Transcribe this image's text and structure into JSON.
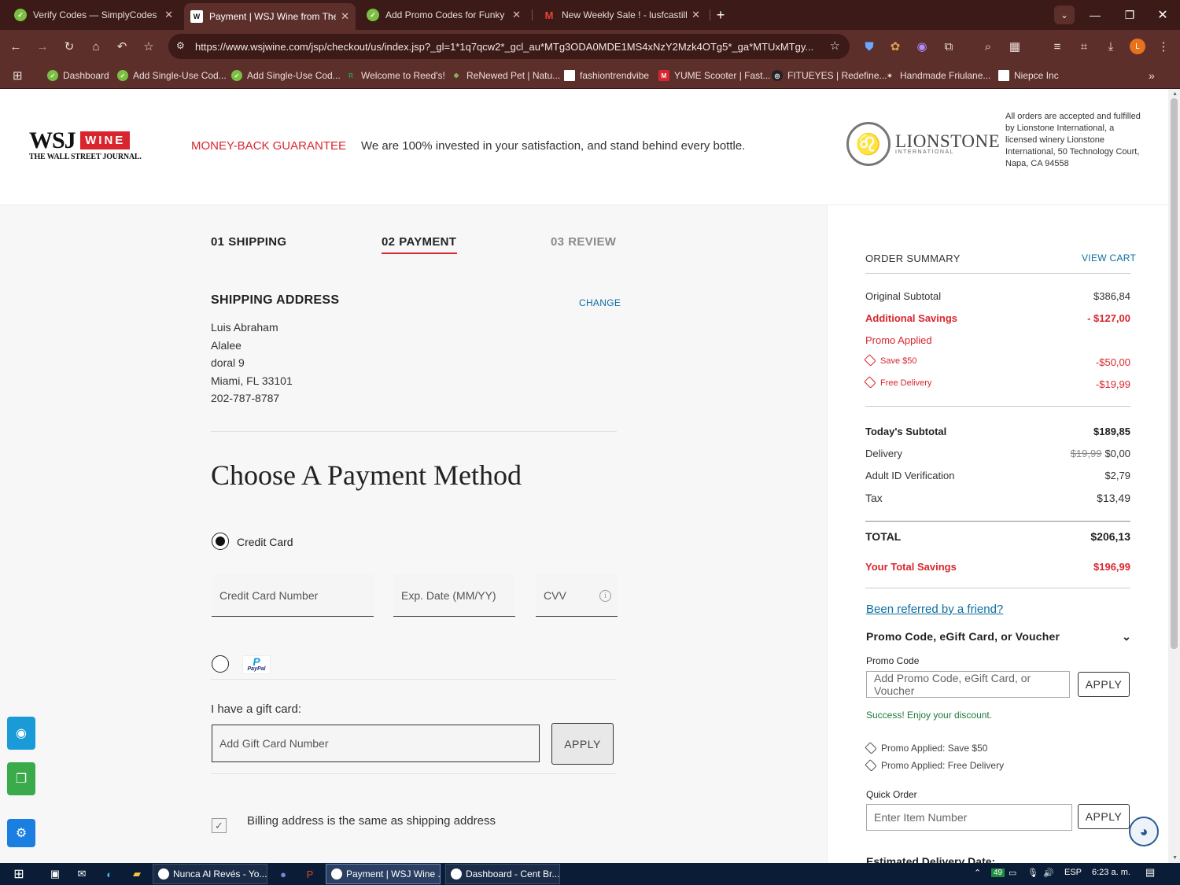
{
  "browser": {
    "tabs": [
      {
        "label": "Verify Codes — SimplyCodes",
        "favicon": "simplycodes-icon",
        "active": false
      },
      {
        "label": "Payment | WSJ Wine from The W",
        "favicon": "wsj-icon",
        "active": true
      },
      {
        "label": "Add Promo Codes for Funky M",
        "favicon": "simplycodes-icon",
        "active": false
      },
      {
        "label": "New Weekly Sale ! - lusfcastillo",
        "favicon": "gmail-icon",
        "active": false
      }
    ],
    "url": "https://www.wsjwine.com/jsp/checkout/us/index.jsp?_gl=1*1q7qcw2*_gcl_au*MTg3ODA0MDE1MS4xNzY2Mzk4OTg5*_ga*MTUxMTgy...",
    "profile_initial": "L",
    "bookmarks": [
      {
        "label": "Dashboard",
        "icon": "simplycodes-icon"
      },
      {
        "label": "Add Single-Use Cod...",
        "icon": "simplycodes-icon"
      },
      {
        "label": "Add Single-Use Cod...",
        "icon": "simplycodes-icon"
      },
      {
        "label": "Welcome to Reed's!",
        "icon": "reeds-icon"
      },
      {
        "label": "ReNewed Pet | Natu...",
        "icon": "paw-icon"
      },
      {
        "label": "fashiontrendvibe",
        "icon": "page-icon"
      },
      {
        "label": "YUME Scooter | Fast...",
        "icon": "yume-icon"
      },
      {
        "label": "FITUEYES | Redefine...",
        "icon": "fitueyes-icon"
      },
      {
        "label": "Handmade Friulane...",
        "icon": "handmade-icon"
      },
      {
        "label": "Niepce Inc",
        "icon": "page-icon"
      }
    ]
  },
  "header": {
    "logo_wsj": "WSJ",
    "logo_wine": "WINE",
    "logo_sub": "THE WALL STREET JOURNAL.",
    "guarantee_title": "MONEY-BACK GUARANTEE",
    "guarantee_text": "We are 100% invested in your satisfaction, and stand behind every bottle.",
    "lionstone_name": "LIONSTONE",
    "lionstone_sub": "INTERNATIONAL",
    "lionstone_note": "All orders are accepted and fulfilled by Lionstone International, a licensed winery Lionstone International, 50 Technology Court, Napa, CA 94558"
  },
  "steps": [
    {
      "num": "01",
      "label": "SHIPPING"
    },
    {
      "num": "02",
      "label": "PAYMENT"
    },
    {
      "num": "03",
      "label": "REVIEW"
    }
  ],
  "shipping": {
    "title": "SHIPPING ADDRESS",
    "change": "CHANGE",
    "lines": [
      "Luis Abraham",
      "Alalee",
      "doral 9",
      "Miami, FL 33101",
      "202-787-8787"
    ]
  },
  "payment": {
    "title": "Choose A Payment Method",
    "credit_card_label": "Credit Card",
    "card_number_placeholder": "Credit Card Number",
    "exp_placeholder": "Exp. Date (MM/YY)",
    "cvv_placeholder": "CVV",
    "paypal_text": "PayPal",
    "gift_label": "I have a gift card:",
    "gift_placeholder": "Add Gift Card Number",
    "gift_apply": "APPLY",
    "billing_same": "Billing address is the same as shipping address"
  },
  "summary": {
    "title": "ORDER SUMMARY",
    "view_cart": "VIEW CART",
    "original_subtotal_label": "Original Subtotal",
    "original_subtotal": "$386,84",
    "additional_savings_label": "Additional Savings",
    "additional_savings": "- $127,00",
    "promo_applied_label": "Promo Applied",
    "promos": [
      {
        "label": "Save $50",
        "value": "-$50,00"
      },
      {
        "label": "Free Delivery",
        "value": "-$19,99"
      }
    ],
    "todays_subtotal_label": "Today's Subtotal",
    "todays_subtotal": "$189,85",
    "delivery_label": "Delivery",
    "delivery_old": "$19,99",
    "delivery": "$0,00",
    "adult_id_label": "Adult ID Verification",
    "adult_id": "$2,79",
    "tax_label": "Tax",
    "tax": "$13,49",
    "total_label": "TOTAL",
    "total": "$206,13",
    "total_savings_label": "Your Total Savings",
    "total_savings": "$196,99",
    "referred": "Been referred by a friend?",
    "promo_section_title": "Promo Code, eGift Card, or Voucher",
    "promo_code_label": "Promo Code",
    "promo_placeholder": "Add Promo Code, eGift Card, or Voucher",
    "promo_apply": "APPLY",
    "success": "Success! Enjoy your discount.",
    "applied_list": [
      "Promo Applied: Save $50",
      "Promo Applied: Free Delivery"
    ],
    "quick_order_label": "Quick Order",
    "quick_order_placeholder": "Enter Item Number",
    "quick_order_apply": "APPLY",
    "estimated_delivery": "Estimated Delivery Date:"
  },
  "taskbar": {
    "apps": [
      {
        "label": "Nunca Al Revés - Yo...",
        "active": false
      },
      {
        "label": "Payment | WSJ Wine ...",
        "active": true
      },
      {
        "label": "Dashboard - Cent Br...",
        "active": false
      }
    ],
    "badge": "49",
    "language": "ESP",
    "time": "6:23 a. m."
  },
  "colors": {
    "brand_red": "#d9262e",
    "link_blue": "#0b6ea1",
    "chrome_dark": "#3b1a18",
    "chrome": "#5c2f2b"
  }
}
